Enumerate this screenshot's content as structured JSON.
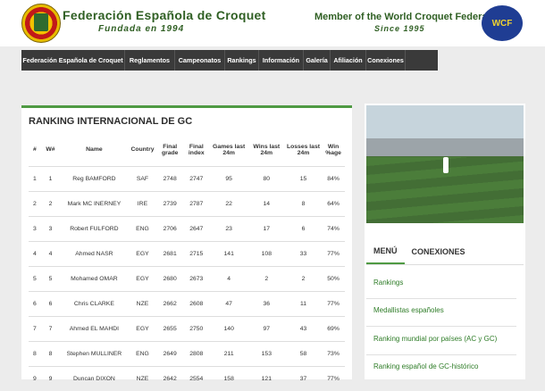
{
  "header": {
    "title_left": "Federación Española de Croquet",
    "subtitle_left": "Fundada en 1994",
    "title_right": "Member of the World Croquet Federation",
    "subtitle_right": "Since 1995",
    "wcf_text": "WCF"
  },
  "nav": [
    {
      "label": "Federación Española de Croquet"
    },
    {
      "label": "Reglamentos"
    },
    {
      "label": "Campeonatos"
    },
    {
      "label": "Rankings"
    },
    {
      "label": "Información"
    },
    {
      "label": "Galería"
    },
    {
      "label": "Afiliación"
    },
    {
      "label": "Conexiones"
    }
  ],
  "ranking": {
    "title": "RANKING INTERNACIONAL DE GC",
    "headers": [
      "#",
      "W#",
      "Name",
      "Country",
      "Final grade",
      "Final index",
      "Games last 24m",
      "Wins last 24m",
      "Losses last 24m",
      "Win %age"
    ],
    "rows": [
      [
        "1",
        "1",
        "Reg BAMFORD",
        "SAF",
        "2748",
        "2747",
        "95",
        "80",
        "15",
        "84%"
      ],
      [
        "2",
        "2",
        "Mark MC INERNEY",
        "IRE",
        "2739",
        "2787",
        "22",
        "14",
        "8",
        "64%"
      ],
      [
        "3",
        "3",
        "Robert FULFORD",
        "ENG",
        "2706",
        "2647",
        "23",
        "17",
        "6",
        "74%"
      ],
      [
        "4",
        "4",
        "Ahmed NASR",
        "EGY",
        "2681",
        "2715",
        "141",
        "108",
        "33",
        "77%"
      ],
      [
        "5",
        "5",
        "Mohamed OMAR",
        "EGY",
        "2680",
        "2673",
        "4",
        "2",
        "2",
        "50%"
      ],
      [
        "6",
        "6",
        "Chris CLARKE",
        "NZE",
        "2662",
        "2608",
        "47",
        "36",
        "11",
        "77%"
      ],
      [
        "7",
        "7",
        "Ahmed EL MAHDI",
        "EGY",
        "2655",
        "2750",
        "140",
        "97",
        "43",
        "69%"
      ],
      [
        "8",
        "8",
        "Stephen MULLINER",
        "ENG",
        "2649",
        "2808",
        "211",
        "153",
        "58",
        "73%"
      ],
      [
        "9",
        "9",
        "Duncan DIXON",
        "NZE",
        "2642",
        "2554",
        "158",
        "121",
        "37",
        "77%"
      ]
    ]
  },
  "sidebar": {
    "tabs": [
      {
        "label": "MENÚ"
      },
      {
        "label": "CONEXIONES"
      }
    ],
    "menu": [
      {
        "label": "Rankings"
      },
      {
        "label": "Medallistas españoles"
      },
      {
        "label": "Ranking mundial por países (AC y GC)"
      },
      {
        "label": "Ranking español de GC-histórico"
      }
    ]
  },
  "colors": {
    "green": "#4f9a43",
    "nav": "#3a3a3a"
  }
}
